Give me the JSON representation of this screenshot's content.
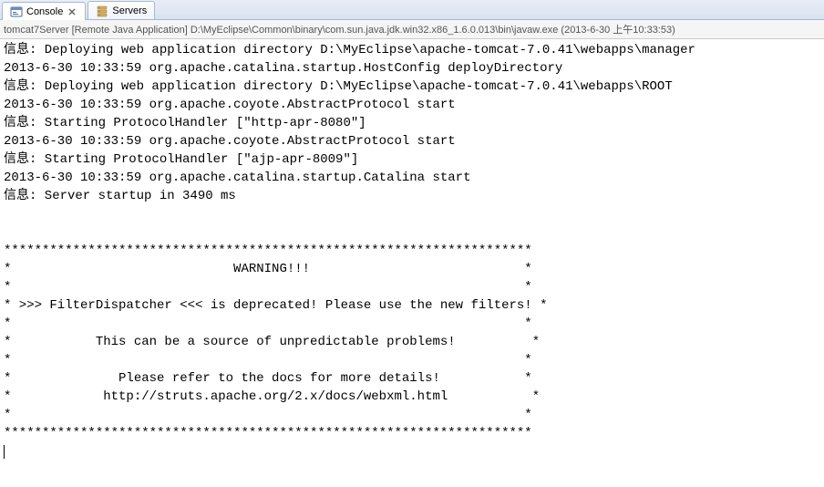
{
  "tabs": {
    "console": "Console",
    "servers": "Servers"
  },
  "process_info": "tomcat7Server [Remote Java Application] D:\\MyEclipse\\Common\\binary\\com.sun.java.jdk.win32.x86_1.6.0.013\\bin\\javaw.exe (2013-6-30 上午10:33:53)",
  "output_lines": [
    "信息: Deploying web application directory D:\\MyEclipse\\apache-tomcat-7.0.41\\webapps\\manager",
    "2013-6-30 10:33:59 org.apache.catalina.startup.HostConfig deployDirectory",
    "信息: Deploying web application directory D:\\MyEclipse\\apache-tomcat-7.0.41\\webapps\\ROOT",
    "2013-6-30 10:33:59 org.apache.coyote.AbstractProtocol start",
    "信息: Starting ProtocolHandler [\"http-apr-8080\"]",
    "2013-6-30 10:33:59 org.apache.coyote.AbstractProtocol start",
    "信息: Starting ProtocolHandler [\"ajp-apr-8009\"]",
    "2013-6-30 10:33:59 org.apache.catalina.startup.Catalina start",
    "信息: Server startup in 3490 ms",
    "",
    "",
    "*********************************************************************",
    "*                             WARNING!!!                            *",
    "*                                                                   *",
    "* >>> FilterDispatcher <<< is deprecated! Please use the new filters! *",
    "*                                                                   *",
    "*           This can be a source of unpredictable problems!          *",
    "*                                                                   *",
    "*              Please refer to the docs for more details!           *",
    "*            http://struts.apache.org/2.x/docs/webxml.html           *",
    "*                                                                   *",
    "*********************************************************************"
  ]
}
